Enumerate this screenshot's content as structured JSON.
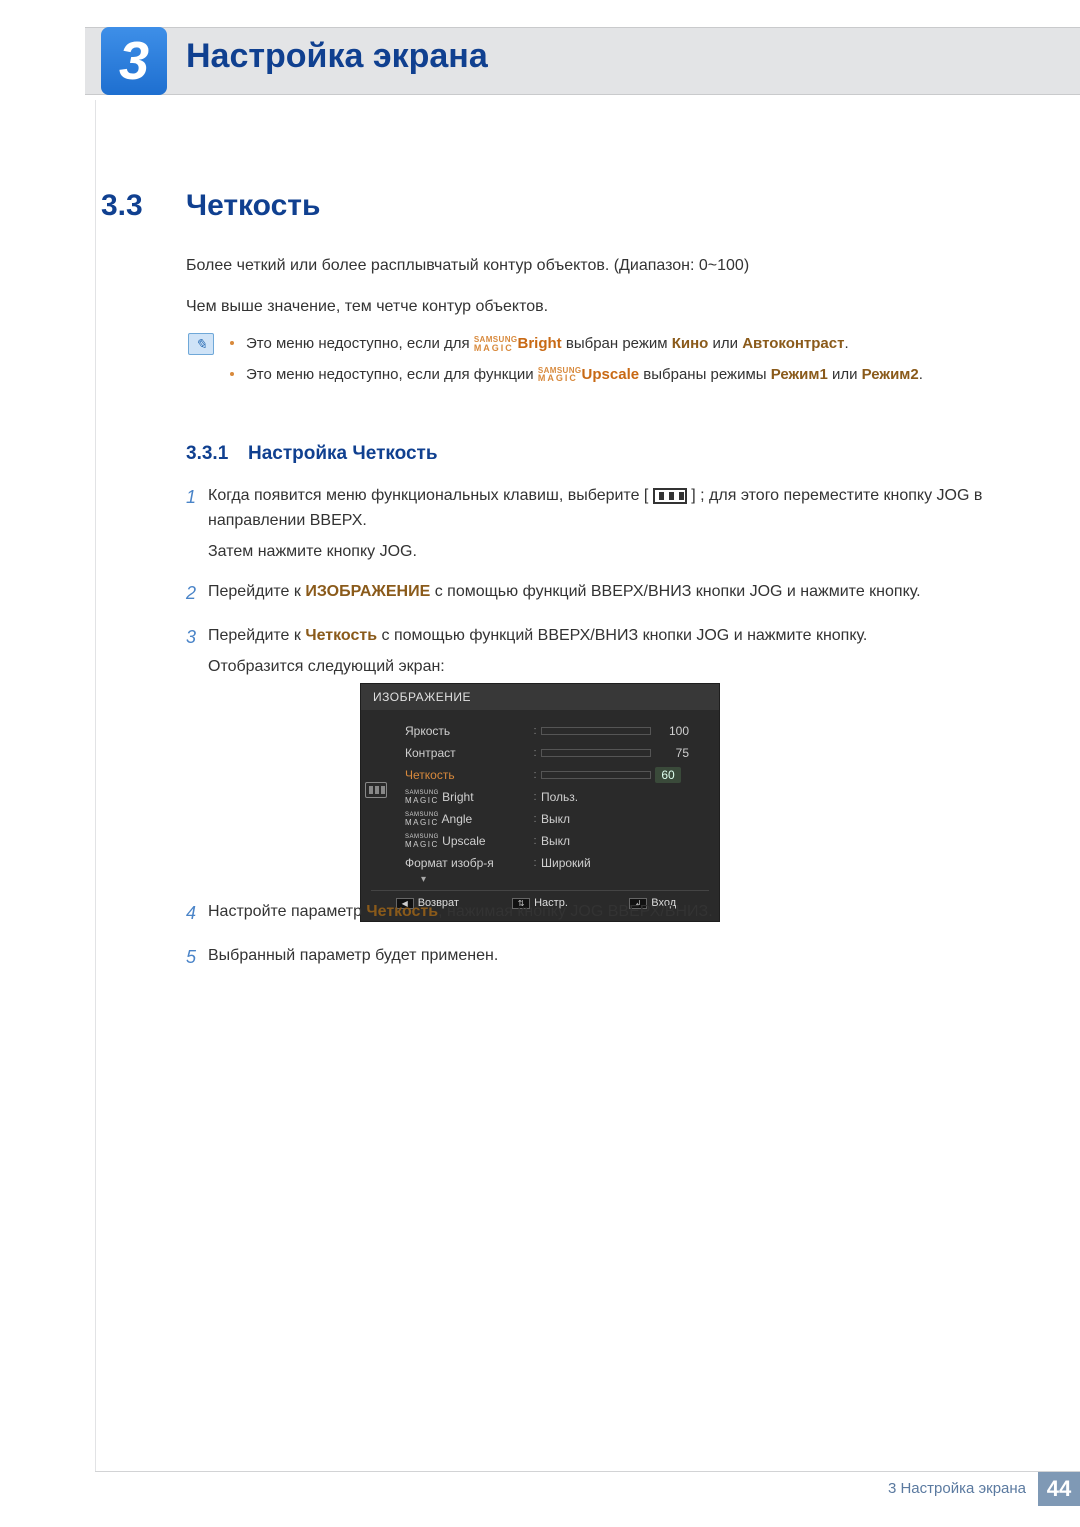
{
  "header": {
    "chapter_number": "3",
    "chapter_title": "Настройка экрана"
  },
  "section": {
    "number": "3.3",
    "title": "Четкость",
    "para1": "Более четкий или более расплывчатый контур объектов. (Диапазон: 0~100)",
    "para2": "Чем выше значение, тем четче контур объектов."
  },
  "notes": {
    "item1_pre": "Это меню недоступно, если для ",
    "magic_top": "SAMSUNG",
    "magic_bot": "MAGIC",
    "item1_bright": "Bright",
    "item1_mid": " выбран режим ",
    "item1_mode1": "Кино",
    "item1_or": " или ",
    "item1_mode2": "Автоконтраст",
    "item1_end": ".",
    "item2_pre": "Это меню недоступно, если для функции ",
    "item2_upscale": "Upscale",
    "item2_mid": " выбраны режимы ",
    "item2_mode1": "Режим1",
    "item2_or": " или ",
    "item2_mode2": "Режим2",
    "item2_end": "."
  },
  "subsection": {
    "number": "3.3.1",
    "title": "Настройка Четкость"
  },
  "steps": {
    "n1": "1",
    "s1a": "Когда появится меню функциональных клавиш, выберите [",
    "s1b": "] ; для этого переместите кнопку JOG в направлении ВВЕРХ.",
    "s1c": "Затем нажмите кнопку JOG.",
    "n2": "2",
    "s2a": "Перейдите к ",
    "s2_menu": "ИЗОБРАЖЕНИЕ",
    "s2b": " с помощью функций ВВЕРХ/ВНИЗ кнопки JOG и нажмите кнопку.",
    "n3": "3",
    "s3a": "Перейдите к ",
    "s3_item": "Четкость",
    "s3b": " с помощью функций ВВЕРХ/ВНИЗ кнопки JOG и нажмите кнопку.",
    "s3c": "Отобразится следующий экран:",
    "n4": "4",
    "s4a": "Настройте параметр ",
    "s4_item": "Четкость",
    "s4b": ", нажимая кнопку JOG ВВЕРХ/ВНИЗ.",
    "n5": "5",
    "s5": "Выбранный параметр будет применен."
  },
  "osd": {
    "title": "ИЗОБРАЖЕНИЕ",
    "rows": {
      "brightness_label": "Яркость",
      "brightness_val": "100",
      "contrast_label": "Контраст",
      "contrast_val": "75",
      "sharpness_label": "Четкость",
      "sharpness_val": "60",
      "magic_bright_suffix": " Bright",
      "magic_bright_val": "Польз.",
      "magic_angle_suffix": " Angle",
      "magic_angle_val": "Выкл",
      "magic_upscale_suffix": " Upscale",
      "magic_upscale_val": "Выкл",
      "format_label": "Формат изобр-я",
      "format_val": "Широкий",
      "magic_top": "SAMSUNG",
      "magic_bot": "MAGIC"
    },
    "arrow": "▾",
    "footer": {
      "back_icon": "◀",
      "back": "Возврат",
      "adjust_icon": "⇅",
      "adjust": "Настр.",
      "enter_icon": "↲",
      "enter": "Вход"
    }
  },
  "footer": {
    "text": "3 Настройка экрана",
    "page": "44"
  }
}
